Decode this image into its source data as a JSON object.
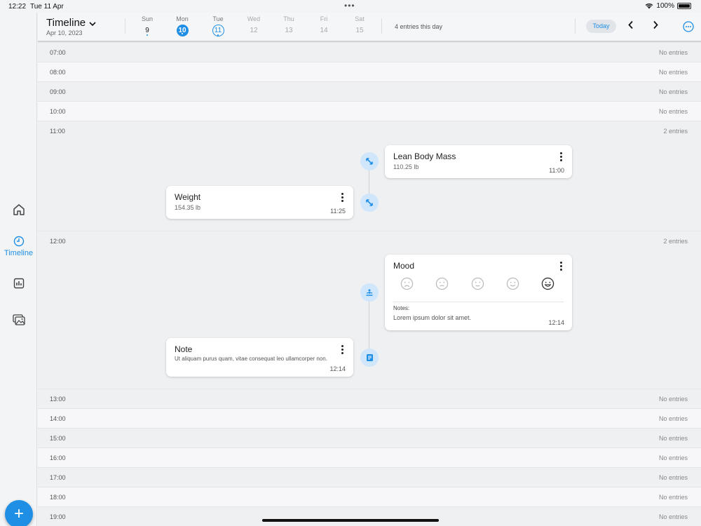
{
  "status_bar": {
    "time": "12:22",
    "date": "Tue 11 Apr",
    "battery": "100%"
  },
  "sidebar": {
    "items": [
      {
        "id": "home",
        "icon": "home-icon",
        "label": ""
      },
      {
        "id": "timeline",
        "icon": "clock-icon",
        "label": "Timeline",
        "active": true
      },
      {
        "id": "charts",
        "icon": "chart-icon",
        "label": ""
      },
      {
        "id": "photos",
        "icon": "photos-icon",
        "label": ""
      }
    ],
    "fab_label": "+"
  },
  "header": {
    "title": "Timeline",
    "subtitle": "Apr 10, 2023",
    "days": [
      {
        "name": "Sun",
        "num": "9"
      },
      {
        "name": "Mon",
        "num": "10"
      },
      {
        "name": "Tue",
        "num": "11"
      },
      {
        "name": "Wed",
        "num": "12"
      },
      {
        "name": "Thu",
        "num": "13"
      },
      {
        "name": "Fri",
        "num": "14"
      },
      {
        "name": "Sat",
        "num": "15"
      }
    ],
    "entries_summary": "4 entries this day",
    "today_label": "Today"
  },
  "hours": [
    {
      "label": "07:00",
      "count": "No entries"
    },
    {
      "label": "08:00",
      "count": "No entries"
    },
    {
      "label": "09:00",
      "count": "No entries"
    },
    {
      "label": "10:00",
      "count": "No entries"
    },
    {
      "label": "11:00",
      "count": "2 entries"
    },
    {
      "label": "12:00",
      "count": "2 entries"
    },
    {
      "label": "13:00",
      "count": "No entries"
    },
    {
      "label": "14:00",
      "count": "No entries"
    },
    {
      "label": "15:00",
      "count": "No entries"
    },
    {
      "label": "16:00",
      "count": "No entries"
    },
    {
      "label": "17:00",
      "count": "No entries"
    },
    {
      "label": "18:00",
      "count": "No entries"
    },
    {
      "label": "19:00",
      "count": "No entries"
    }
  ],
  "entries": {
    "lean_body_mass": {
      "title": "Lean Body Mass",
      "value": "110.25 lb",
      "time": "11:00"
    },
    "weight": {
      "title": "Weight",
      "value": "154.35 lb",
      "time": "11:25"
    },
    "mood": {
      "title": "Mood",
      "notes_label": "Notes:",
      "notes": "Lorem ipsum dolor sit amet.",
      "time": "12:14",
      "selected_level": 5,
      "levels": 5
    },
    "note": {
      "title": "Note",
      "text": "Ut aliquam purus quam, vitae consequat leo ullamcorper non.",
      "time": "12:14"
    }
  },
  "colors": {
    "accent": "#1f8fe5",
    "node_bg": "#cfe6fb"
  }
}
